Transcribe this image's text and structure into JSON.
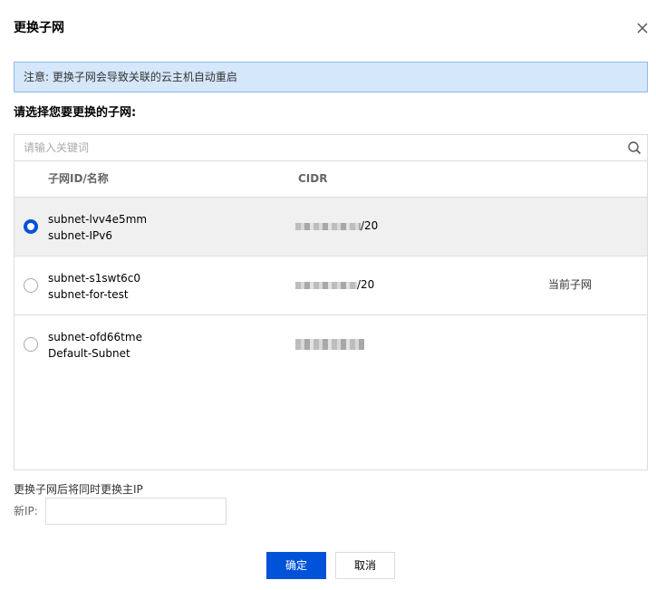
{
  "dialog": {
    "title": "更换子网",
    "close_icon": "close-icon"
  },
  "notice": {
    "text": "注意: 更换子网会导致关联的云主机自动重启"
  },
  "section_label": "请选择您要更换的子网:",
  "search": {
    "placeholder": "请输入关键词",
    "value": "",
    "icon": "search-icon"
  },
  "table": {
    "headers": {
      "name": "子网ID/名称",
      "cidr": "CIDR"
    },
    "rows": [
      {
        "id": "subnet-lvv4e5mm",
        "name": "subnet-IPv6",
        "cidr_suffix": "/20",
        "current": "",
        "selected": true
      },
      {
        "id": "subnet-s1swt6c0",
        "name": "subnet-for-test",
        "cidr_suffix": "/20",
        "current": "当前子网",
        "selected": false
      },
      {
        "id": "subnet-ofd66tme",
        "name": "Default-Subnet",
        "cidr_suffix": "",
        "current": "",
        "selected": false
      }
    ]
  },
  "change_note": "更换子网后将同时更换主IP",
  "ip": {
    "label": "新IP:",
    "value": ""
  },
  "buttons": {
    "ok": "确定",
    "cancel": "取消"
  },
  "colors": {
    "primary": "#0052d9",
    "notice_bg": "#d5e7fa",
    "selected_row_bg": "#f0f0f0"
  }
}
